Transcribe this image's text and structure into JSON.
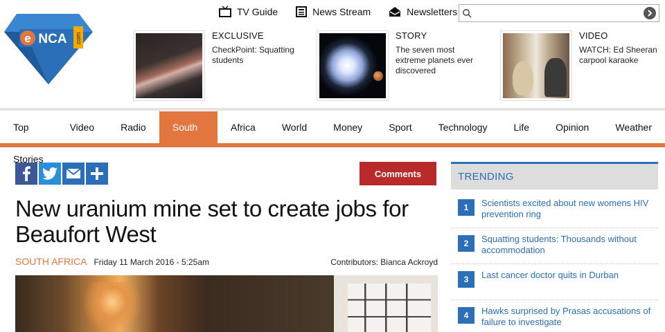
{
  "top_links": [
    {
      "label": "TV Guide",
      "icon": "tv-icon"
    },
    {
      "label": "News Stream",
      "icon": "news-stream-icon"
    },
    {
      "label": "Newsletters",
      "icon": "newsletter-icon"
    }
  ],
  "search": {
    "placeholder": "",
    "value": ""
  },
  "logo": {
    "text": "eNCA",
    "suffix": ".com"
  },
  "promos": [
    {
      "kicker": "EXCLUSIVE",
      "title": "CheckPoint: Squatting students"
    },
    {
      "kicker": "STORY",
      "title": "The seven most extreme planets ever discovered"
    },
    {
      "kicker": "VIDEO",
      "title": "WATCH: Ed Sheeran carpool karaoke"
    }
  ],
  "nav": {
    "items": [
      "Top Stories",
      "Video",
      "Radio",
      "South Africa",
      "Africa",
      "World",
      "Money",
      "Sport",
      "Technology",
      "Life",
      "Opinion",
      "Weather"
    ],
    "active": "South Africa"
  },
  "article": {
    "comments_label": "Comments",
    "headline": "New uranium mine set to create jobs for Beaufort West",
    "section": "SOUTH AFRICA",
    "date": "Friday 11 March 2016 - 5:25am",
    "contributors": "Contributors: Bianca Ackroyd"
  },
  "trending": {
    "title": "TRENDING",
    "items": [
      {
        "num": "1",
        "text": "Scientists excited about new womens HIV prevention ring"
      },
      {
        "num": "2",
        "text": "Squatting students: Thousands without accommodation"
      },
      {
        "num": "3",
        "text": "Last cancer doctor quits in Durban"
      },
      {
        "num": "4",
        "text": "Hawks surprised by Prasas accusations of failure to investigate"
      }
    ]
  },
  "colors": {
    "accent": "#e2763f",
    "blue": "#2a6fb8",
    "comments": "#b92a2a"
  }
}
